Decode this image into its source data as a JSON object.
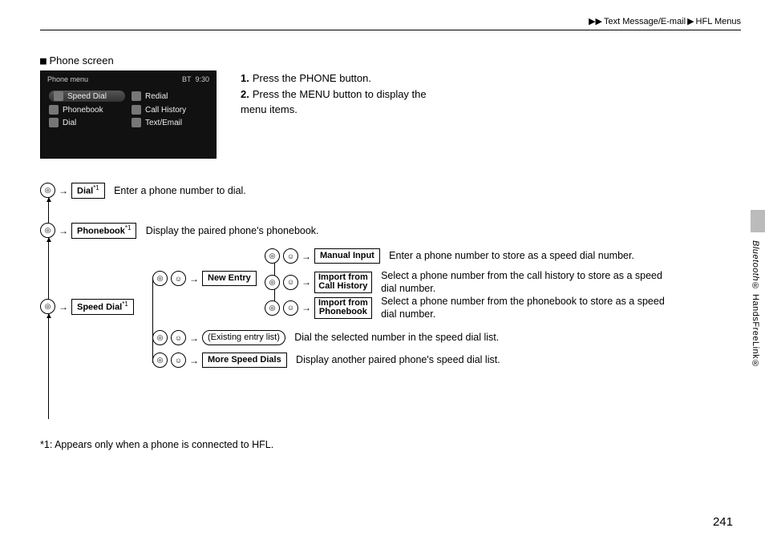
{
  "header": {
    "crumb1": "Text Message/E-mail",
    "crumb2": "HFL Menus"
  },
  "section_title": "Phone screen",
  "screenshot": {
    "title": "Phone menu",
    "bt_icon": "BT",
    "time": "9:30",
    "items": {
      "speed_dial": "Speed Dial",
      "redial": "Redial",
      "phonebook": "Phonebook",
      "call_history": "Call History",
      "dial": "Dial",
      "text_email": "Text/Email"
    }
  },
  "steps": {
    "s1": "Press the PHONE button.",
    "s2": "Press the MENU button to display the menu items."
  },
  "tree": {
    "dial": {
      "label": "Dial",
      "sup": "*1",
      "desc": "Enter a phone number to dial."
    },
    "phonebook": {
      "label": "Phonebook",
      "sup": "*1",
      "desc": "Display the paired phone's phonebook."
    },
    "speed_dial": {
      "label": "Speed Dial",
      "sup": "*1"
    },
    "new_entry": {
      "label": "New Entry"
    },
    "manual_input": {
      "label": "Manual Input",
      "desc": "Enter a phone number to store as a speed dial number."
    },
    "import_call": {
      "label1": "Import from",
      "label2": "Call History",
      "desc": "Select a phone number from the call history to store as a speed dial number."
    },
    "import_pb": {
      "label1": "Import from",
      "label2": "Phonebook",
      "desc": "Select a phone number from the phonebook to store as a speed dial number."
    },
    "existing": {
      "label": "(Existing entry list)",
      "desc": "Dial the selected number in the speed dial list."
    },
    "more": {
      "label": "More Speed Dials",
      "desc": "Display another paired phone's speed dial list."
    }
  },
  "footnote": "*1: Appears only when a phone is connected to HFL.",
  "side": {
    "italic": "Bluetooth",
    "reg1": "® ",
    "rest": "HandsFreeLink®"
  },
  "page_number": "241"
}
